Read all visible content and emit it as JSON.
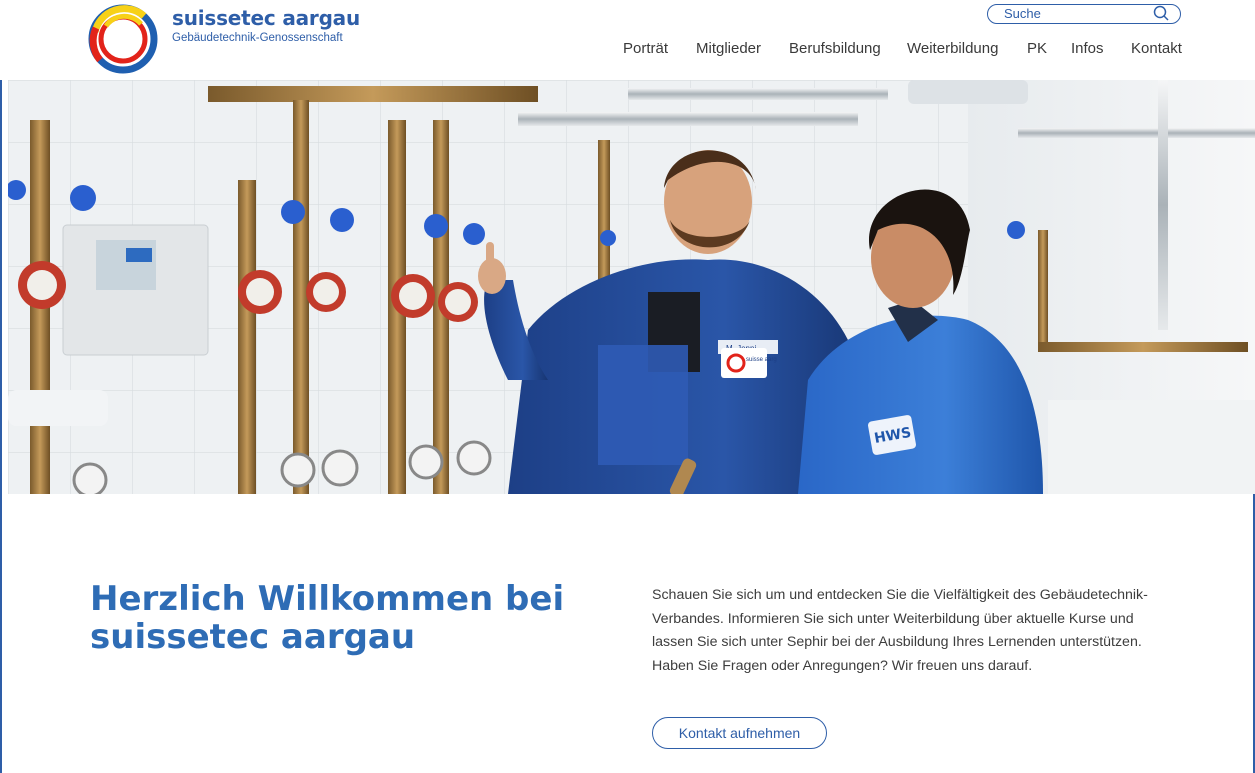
{
  "brand": {
    "name": "suissetec aargau",
    "subtitle": "Gebäudetechnik-Genossenschaft",
    "colors": {
      "primary": "#2e5ea8",
      "heading": "#2e6cb5",
      "logo_red": "#e2231a",
      "logo_yellow": "#f7d117",
      "logo_blue": "#1f5fb0"
    }
  },
  "search": {
    "placeholder": "Suche",
    "icon": "search-icon"
  },
  "nav": {
    "items": [
      {
        "label": "Porträt"
      },
      {
        "label": "Mitglieder"
      },
      {
        "label": "Berufsbildung"
      },
      {
        "label": "Weiterbildung"
      },
      {
        "label": "PK"
      },
      {
        "label": "Infos"
      },
      {
        "label": "Kontakt"
      }
    ]
  },
  "hero": {
    "jacket_badge": "M. Jenni",
    "logo_patch": "suisse aarg",
    "school_patch": "HWS"
  },
  "main": {
    "heading": "Herzlich Willkommen bei suissetec aargau",
    "intro": "Schauen Sie sich um und entdecken Sie die Vielfältigkeit des Gebäudetechnik-Verbandes. Informieren Sie sich unter Weiterbildung über aktuelle Kurse und lassen Sie sich unter Sephir bei der Ausbildung Ihres Lernenden unterstützen. Haben Sie Fragen oder Anregungen? Wir freuen uns darauf.",
    "cta_label": "Kontakt aufnehmen"
  }
}
